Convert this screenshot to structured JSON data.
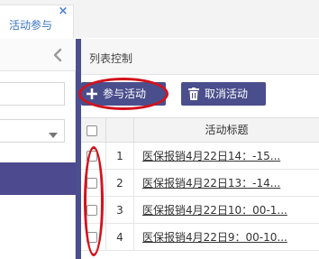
{
  "tab": {
    "label": "活动参与",
    "close_glyph": "×"
  },
  "left_panel": {
    "collapse_icon": "chevron-left-icon",
    "search_value": "",
    "select_value": "",
    "select_icon": "caret-down-icon"
  },
  "main": {
    "title": "列表控制",
    "toolbar": {
      "add_label": "参与活动",
      "add_icon": "plus-icon",
      "cancel_label": "取消活动",
      "cancel_icon": "trash-icon"
    },
    "table": {
      "columns": [
        "",
        "",
        "活动标题"
      ],
      "rows": [
        {
          "num": "1",
          "title": "医保报销4月22日14：-15..."
        },
        {
          "num": "2",
          "title": "医保报销4月22日13：-14..."
        },
        {
          "num": "3",
          "title": "医保报销4月22日10：00-1..."
        },
        {
          "num": "4",
          "title": "医保报销4月22日9：00-10..."
        }
      ]
    }
  },
  "colors": {
    "accent": "#4a4e8c",
    "annotation": "#d3121c",
    "tab_text": "#3b74c4"
  }
}
